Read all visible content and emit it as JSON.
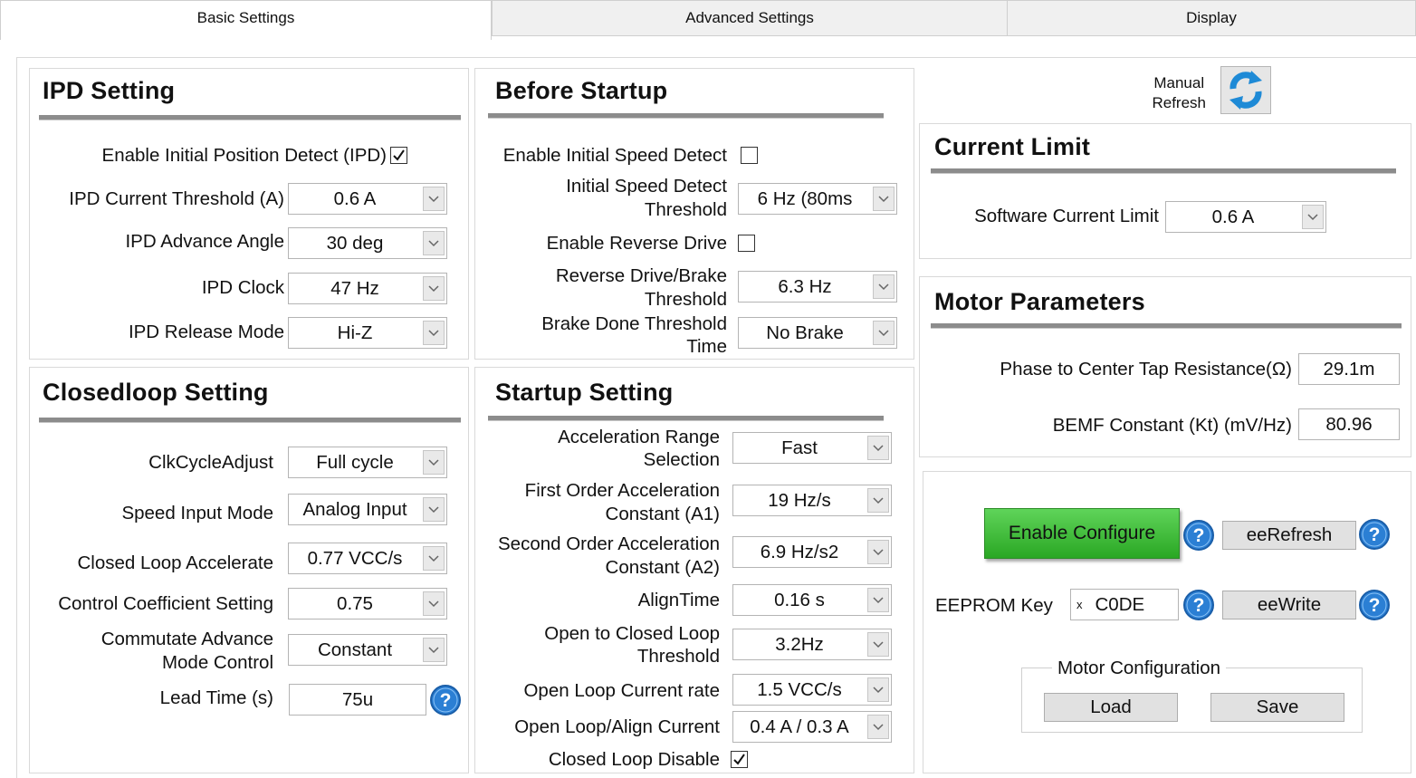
{
  "tabs": [
    "Basic Settings",
    "Advanced Settings",
    "Display"
  ],
  "ipd": {
    "title": "IPD Setting",
    "enable_label": "Enable Initial Position Detect (IPD)",
    "threshold_label": "IPD Current Threshold (A)",
    "threshold_value": "0.6 A",
    "angle_label": "IPD Advance Angle",
    "angle_value": "30 deg",
    "clock_label": "IPD Clock",
    "clock_value": "47 Hz",
    "release_label": "IPD Release Mode",
    "release_value": "Hi-Z"
  },
  "before": {
    "title": "Before Startup",
    "speed_detect_label": "Enable Initial Speed Detect",
    "speed_thresh_label1": "Initial Speed Detect",
    "speed_thresh_label2": "Threshold",
    "speed_thresh_value": "6 Hz (80ms",
    "reverse_label": "Enable Reverse Drive",
    "rev_thresh_label1": "Reverse Drive/Brake",
    "rev_thresh_label2": "Threshold",
    "rev_thresh_value": "6.3 Hz",
    "brake_label1": "Brake Done Threshold",
    "brake_label2": "Time",
    "brake_value": "No Brake"
  },
  "closed": {
    "title": "Closedloop Setting",
    "clk_label": "ClkCycleAdjust",
    "clk_value": "Full cycle",
    "speed_label": "Speed Input Mode",
    "speed_value": "Analog Input",
    "accel_label": "Closed Loop Accelerate",
    "accel_value": "0.77 VCC/s",
    "coef_label": "Control Coefficient Setting",
    "coef_value": "0.75",
    "comm_label1": "Commutate Advance",
    "comm_label2": "Mode Control",
    "comm_value": "Constant",
    "lead_label": "Lead Time (s)",
    "lead_value": "75u"
  },
  "startup": {
    "title": "Startup Setting",
    "acc_range_label1": "Acceleration Range",
    "acc_range_label2": "Selection",
    "acc_range_value": "Fast",
    "a1_label1": "First Order Acceleration",
    "a1_label2": "Constant (A1)",
    "a1_value": "19 Hz/s",
    "a2_label1": "Second Order Acceleration",
    "a2_label2": "Constant (A2)",
    "a2_value": "6.9 Hz/s2",
    "align_label": "AlignTime",
    "align_value": "0.16 s",
    "otc_label1": "Open to Closed Loop",
    "otc_label2": "Threshold",
    "otc_value": "3.2Hz",
    "ol_rate_label": "Open Loop Current rate",
    "ol_rate_value": "1.5 VCC/s",
    "ol_align_label": "Open Loop/Align Current",
    "ol_align_value": "0.4 A / 0.3 A",
    "cl_disable_label": "Closed Loop Disable"
  },
  "refresh": {
    "label1": "Manual",
    "label2": "Refresh"
  },
  "current_limit": {
    "title": "Current Limit",
    "sw_label": "Software Current Limit",
    "sw_value": "0.6 A"
  },
  "motor": {
    "title": "Motor Parameters",
    "res_label": "Phase to Center Tap Resistance(Ω)",
    "res_value": "29.1m",
    "bemf_label": "BEMF Constant (Kt) (mV/Hz)",
    "bemf_value": "80.96"
  },
  "eeprom": {
    "enable_label": "Enable Configure",
    "refresh_label": "eeRefresh",
    "key_label": "EEPROM Key",
    "key_prefix": "x",
    "key_value": "C0DE",
    "write_label": "eeWrite",
    "group_label": "Motor Configuration",
    "load_label": "Load",
    "save_label": "Save"
  },
  "icons": {
    "help": "help-icon",
    "refresh": "refresh-icon",
    "dropdown": "chevron-down-icon"
  },
  "colors": {
    "accent_green": "#3bbf35",
    "help_blue": "#2b7fd4",
    "title_line": "#8c8c8c"
  },
  "checks": {
    "ipd_enable": true,
    "speed_detect": false,
    "reverse": false,
    "cl_disable": true
  }
}
